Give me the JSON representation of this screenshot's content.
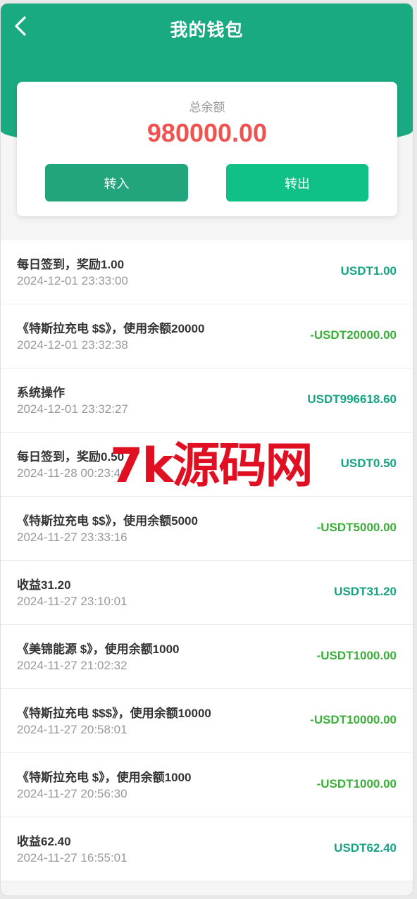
{
  "header": {
    "title": "我的钱包",
    "back_icon": "chevron-left-icon"
  },
  "balance": {
    "label": "总余额",
    "amount": "980000.00",
    "transfer_in_label": "转入",
    "transfer_out_label": "转出"
  },
  "colors": {
    "brand": "#1aaa82",
    "amount_red": "#ef5350",
    "positive": "#17a383",
    "negative": "#3cae3a"
  },
  "transactions": [
    {
      "title": "每日签到，奖励1.00",
      "time": "2024-12-01 23:33:00",
      "amount": "USDT1.00",
      "direction": "positive"
    },
    {
      "title": "《特斯拉充电 $$》，使用余额20000",
      "time": "2024-12-01 23:32:38",
      "amount": "-USDT20000.00",
      "direction": "negative"
    },
    {
      "title": "系统操作",
      "time": "2024-12-01 23:32:27",
      "amount": "USDT996618.60",
      "direction": "positive"
    },
    {
      "title": "每日签到，奖励0.50",
      "time": "2024-11-28 00:23:40",
      "amount": "USDT0.50",
      "direction": "positive"
    },
    {
      "title": "《特斯拉充电 $$》，使用余额5000",
      "time": "2024-11-27 23:33:16",
      "amount": "-USDT5000.00",
      "direction": "negative"
    },
    {
      "title": "收益31.20",
      "time": "2024-11-27 23:10:01",
      "amount": "USDT31.20",
      "direction": "positive"
    },
    {
      "title": "《美锦能源 $》，使用余额1000",
      "time": "2024-11-27 21:02:32",
      "amount": "-USDT1000.00",
      "direction": "negative"
    },
    {
      "title": "《特斯拉充电 $$$》，使用余额10000",
      "time": "2024-11-27 20:58:01",
      "amount": "-USDT10000.00",
      "direction": "negative"
    },
    {
      "title": "《特斯拉充电 $》，使用余额1000",
      "time": "2024-11-27 20:56:30",
      "amount": "-USDT1000.00",
      "direction": "negative"
    },
    {
      "title": "收益62.40",
      "time": "2024-11-27 16:55:01",
      "amount": "USDT62.40",
      "direction": "positive"
    }
  ],
  "watermark": {
    "text": "7k源码网"
  }
}
